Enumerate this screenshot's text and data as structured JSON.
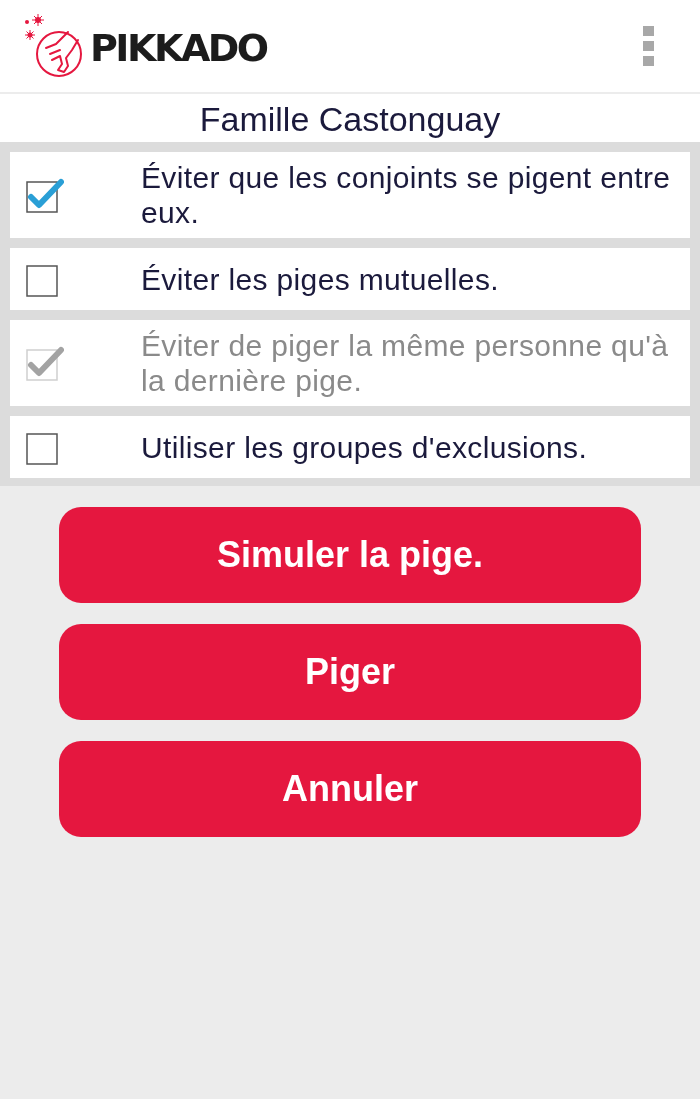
{
  "app_bar": {
    "logo_text": "PIKKADO"
  },
  "title": "Famille Castonguay",
  "options": [
    {
      "label": "Éviter que les conjoints se pigent entre eux.",
      "checked": true,
      "disabled": false
    },
    {
      "label": "Éviter les piges mutuelles.",
      "checked": false,
      "disabled": false
    },
    {
      "label": "Éviter de piger la même personne qu'à la dernière pige.",
      "checked": true,
      "disabled": true
    },
    {
      "label": "Utiliser les groupes d'exclusions.",
      "checked": false,
      "disabled": false
    }
  ],
  "buttons": [
    "Simuler la pige.",
    "Piger",
    "Annuler"
  ]
}
